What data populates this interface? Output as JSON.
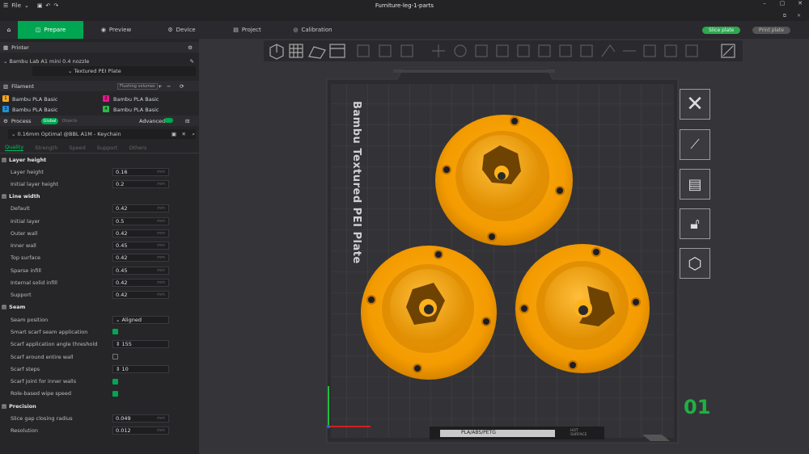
{
  "window": {
    "title": "Furniture-leg-1-parts",
    "menu_label": "File"
  },
  "tabs": [
    "Prepare",
    "Preview",
    "Device",
    "Project",
    "Calibration"
  ],
  "actions": {
    "slice": "Slice plate",
    "print": "Print plate"
  },
  "printer": {
    "section": "Printer",
    "name": "Bambu Lab A1 mini 0.4 nozzle",
    "plate": "Textured PEI Plate"
  },
  "filament": {
    "section": "Filament",
    "flushing": "Flushing volumes",
    "slots": [
      {
        "num": "1",
        "name": "Bambu PLA Basic",
        "color": "#f5a623"
      },
      {
        "num": "2",
        "name": "Bambu PLA Basic",
        "color": "#e6178a"
      },
      {
        "num": "3",
        "name": "Bambu PLA Basic",
        "color": "#1e90d6"
      },
      {
        "num": "4",
        "name": "Bambu PLA Basic",
        "color": "#2fb84a"
      }
    ]
  },
  "process": {
    "section": "Process",
    "global": "Global",
    "objects": "Objects",
    "advanced": "Advanced",
    "preset": "0.16mm Optimal @BBL A1M - Keychain",
    "tabs": [
      "Quality",
      "Strength",
      "Speed",
      "Support",
      "Others"
    ]
  },
  "settings": {
    "layer_height": {
      "title": "Layer height",
      "items": [
        {
          "label": "Layer height",
          "value": "0.16",
          "unit": "mm"
        },
        {
          "label": "Initial layer height",
          "value": "0.2",
          "unit": "mm"
        }
      ]
    },
    "line_width": {
      "title": "Line width",
      "items": [
        {
          "label": "Default",
          "value": "0.42",
          "unit": "mm"
        },
        {
          "label": "Initial layer",
          "value": "0.5",
          "unit": "mm"
        },
        {
          "label": "Outer wall",
          "value": "0.42",
          "unit": "mm"
        },
        {
          "label": "Inner wall",
          "value": "0.45",
          "unit": "mm"
        },
        {
          "label": "Top surface",
          "value": "0.42",
          "unit": "mm"
        },
        {
          "label": "Sparse infill",
          "value": "0.45",
          "unit": "mm"
        },
        {
          "label": "Internal solid infill",
          "value": "0.42",
          "unit": "mm"
        },
        {
          "label": "Support",
          "value": "0.42",
          "unit": "mm"
        }
      ]
    },
    "seam": {
      "title": "Seam",
      "position_label": "Seam position",
      "position_value": "Aligned",
      "smart_scarf": "Smart scarf seam application",
      "angle_label": "Scarf application angle threshold",
      "angle_value": "155",
      "around_wall": "Scarf around entire wall",
      "steps_label": "Scarf steps",
      "steps_value": "10",
      "inner_walls": "Scarf joint for inner walls",
      "role_wipe": "Role-based wipe speed"
    },
    "precision": {
      "title": "Precision",
      "items": [
        {
          "label": "Slice gap closing radius",
          "value": "0.049",
          "unit": "mm"
        },
        {
          "label": "Resolution",
          "value": "0.012",
          "unit": "mm"
        }
      ]
    }
  },
  "plate": {
    "label": "Bambu Textured PEI Plate",
    "number": "01",
    "filament_types": "PLA/ABS/PETG",
    "hot_surface": "HOT SURFACE",
    "accent": "#f5a400"
  }
}
